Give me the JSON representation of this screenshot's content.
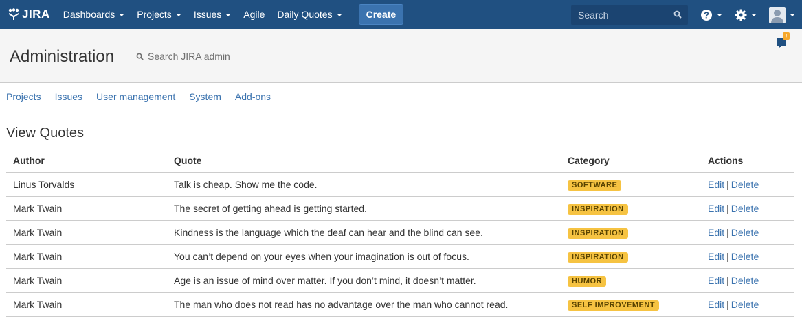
{
  "header": {
    "logo_text": "JIRA",
    "nav": [
      {
        "label": "Dashboards",
        "has_caret": true
      },
      {
        "label": "Projects",
        "has_caret": true
      },
      {
        "label": "Issues",
        "has_caret": true
      },
      {
        "label": "Agile",
        "has_caret": false
      },
      {
        "label": "Daily Quotes",
        "has_caret": true
      }
    ],
    "create_label": "Create",
    "search_placeholder": "Search",
    "icons": [
      "help-icon",
      "settings-icon",
      "user-avatar-icon"
    ],
    "bg_color": "#205081",
    "create_color": "#3b73af"
  },
  "admin": {
    "title": "Administration",
    "search_label": "Search JIRA admin",
    "notification_badge": "!",
    "tabs": [
      "Projects",
      "Issues",
      "User management",
      "System",
      "Add-ons"
    ]
  },
  "page": {
    "title": "View Quotes",
    "columns": {
      "author": "Author",
      "quote": "Quote",
      "category": "Category",
      "actions": "Actions"
    },
    "edit_label": "Edit",
    "separator": "|",
    "delete_label": "Delete",
    "lozenge_color": "#f6c342",
    "rows": [
      {
        "author": "Linus Torvalds",
        "quote": "Talk is cheap. Show me the code.",
        "category": "SOFTWARE"
      },
      {
        "author": "Mark Twain",
        "quote": "The secret of getting ahead is getting started.",
        "category": "INSPIRATION"
      },
      {
        "author": "Mark Twain",
        "quote": "Kindness is the language which the deaf can hear and the blind can see.",
        "category": "INSPIRATION"
      },
      {
        "author": "Mark Twain",
        "quote": "You can’t depend on your eyes when your imagination is out of focus.",
        "category": "INSPIRATION"
      },
      {
        "author": "Mark Twain",
        "quote": "Age is an issue of mind over matter. If you don’t mind, it doesn’t matter.",
        "category": "HUMOR"
      },
      {
        "author": "Mark Twain",
        "quote": "The man who does not read has no advantage over the man who cannot read.",
        "category": "SELF IMPROVEMENT"
      }
    ]
  }
}
